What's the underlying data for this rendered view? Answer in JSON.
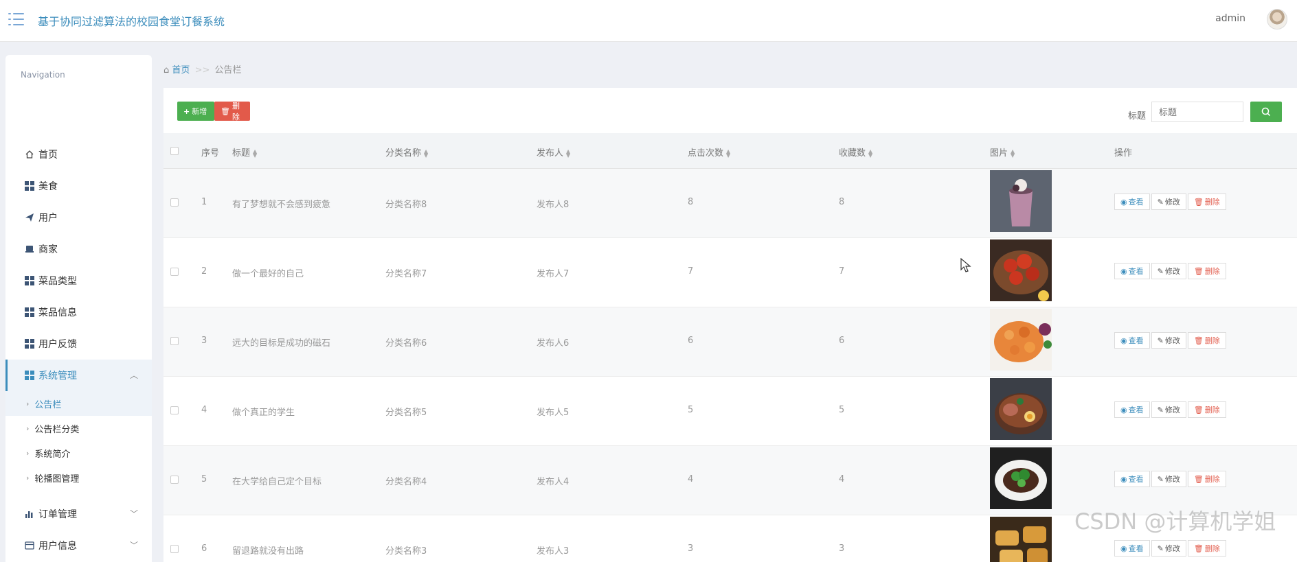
{
  "header": {
    "title": "基于协同过滤算法的校园食堂订餐系统",
    "user": "admin"
  },
  "sidebar": {
    "heading": "Navigation",
    "items": [
      {
        "label": "首页",
        "icon": "home-icon"
      },
      {
        "label": "美食",
        "icon": "grid-icon"
      },
      {
        "label": "用户",
        "icon": "send-icon"
      },
      {
        "label": "商家",
        "icon": "shop-icon"
      },
      {
        "label": "菜品类型",
        "icon": "grid-icon"
      },
      {
        "label": "菜品信息",
        "icon": "grid-icon"
      },
      {
        "label": "用户反馈",
        "icon": "grid-icon"
      },
      {
        "label": "系统管理",
        "icon": "grid-icon"
      },
      {
        "label": "订单管理",
        "icon": "bar-chart-icon"
      },
      {
        "label": "用户信息",
        "icon": "card-icon"
      }
    ],
    "sub_items": [
      "公告栏",
      "公告栏分类",
      "系统简介",
      "轮播图管理"
    ]
  },
  "breadcrumb": {
    "home": "首页",
    "sep": ">>",
    "current": "公告栏"
  },
  "toolbar": {
    "add_label": "新增",
    "delete_label": "删除",
    "search_label": "标题",
    "search_placeholder": "标题"
  },
  "table": {
    "headers": [
      "序号",
      "标题",
      "分类名称",
      "发布人",
      "点击次数",
      "收藏数",
      "图片",
      "操作"
    ],
    "actions": {
      "view": "查看",
      "edit": "修改",
      "delete": "删除"
    },
    "rows": [
      {
        "no": "1",
        "title": "有了梦想就不会感到疲惫",
        "category": "分类名称8",
        "publisher": "发布人8",
        "clicks": "8",
        "favorites": "8"
      },
      {
        "no": "2",
        "title": "做一个最好的自己",
        "category": "分类名称7",
        "publisher": "发布人7",
        "clicks": "7",
        "favorites": "7"
      },
      {
        "no": "3",
        "title": "远大的目标是成功的磁石",
        "category": "分类名称6",
        "publisher": "发布人6",
        "clicks": "6",
        "favorites": "6"
      },
      {
        "no": "4",
        "title": "做个真正的学生",
        "category": "分类名称5",
        "publisher": "发布人5",
        "clicks": "5",
        "favorites": "5"
      },
      {
        "no": "5",
        "title": "在大学给自己定个目标",
        "category": "分类名称4",
        "publisher": "发布人4",
        "clicks": "4",
        "favorites": "4"
      },
      {
        "no": "6",
        "title": "留退路就没有出路",
        "category": "分类名称3",
        "publisher": "发布人3",
        "clicks": "3",
        "favorites": "3"
      }
    ]
  },
  "watermark": "CSDN @计算机学姐"
}
